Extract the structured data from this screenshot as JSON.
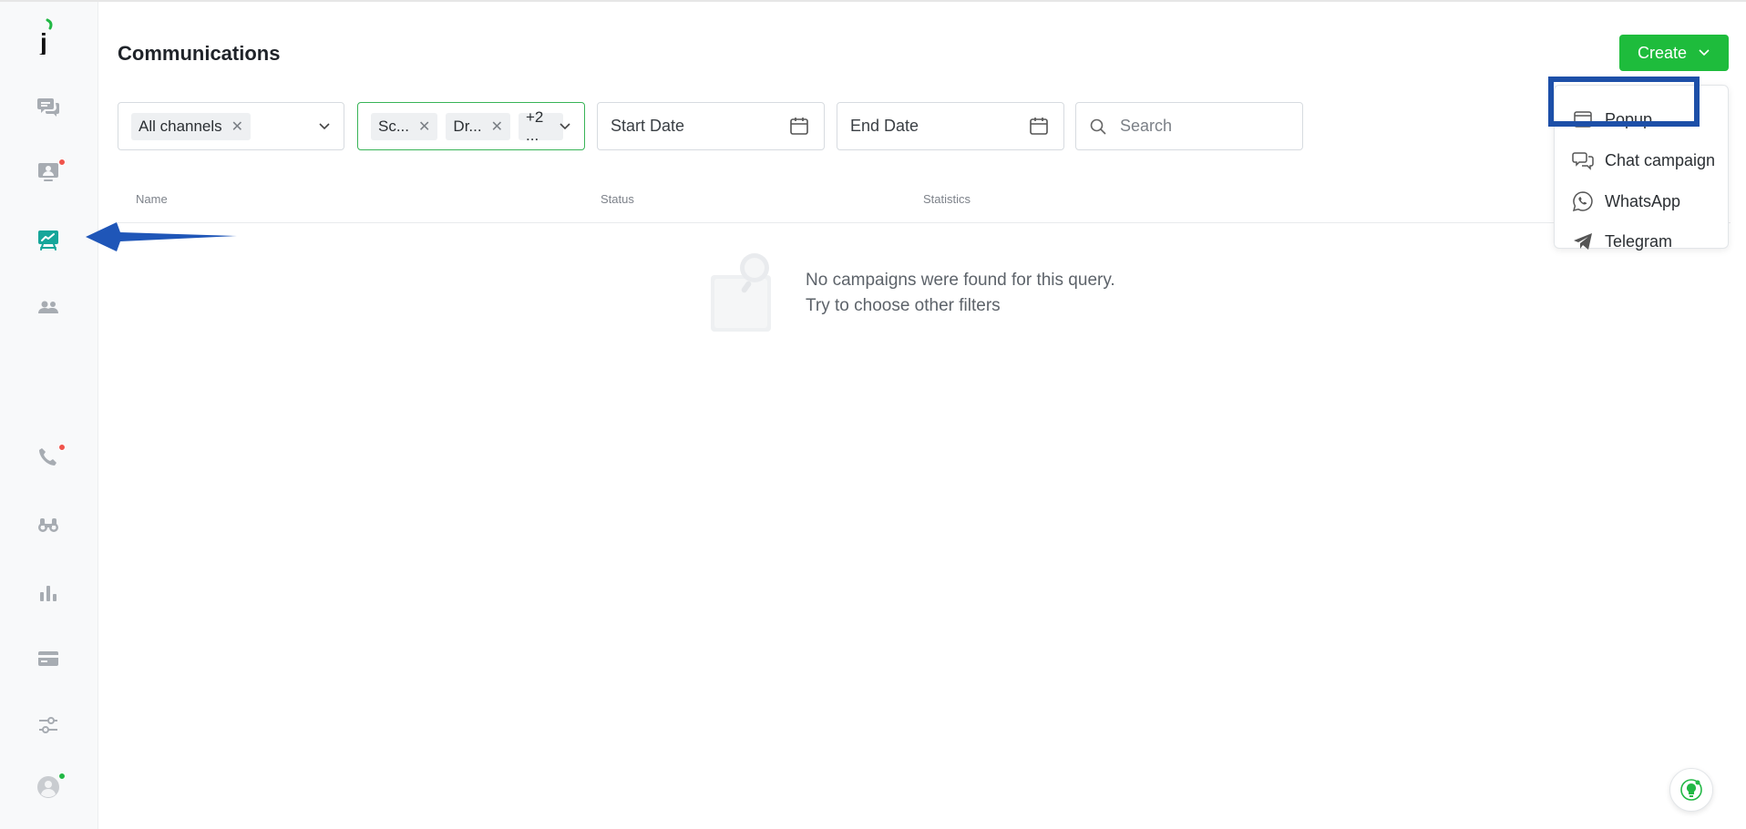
{
  "page": {
    "title": "Communications"
  },
  "header": {
    "create_label": "Create"
  },
  "filters": {
    "channels": {
      "chips": [
        "All channels"
      ]
    },
    "statuses": {
      "chips": [
        "Sc...",
        "Dr...",
        "+2 ..."
      ]
    },
    "start_date_placeholder": "Start Date",
    "end_date_placeholder": "End Date",
    "search_placeholder": "Search"
  },
  "table": {
    "columns": [
      "Name",
      "Status",
      "Statistics"
    ]
  },
  "empty_state": {
    "line1": "No campaigns were found for this query.",
    "line2": "Try to choose other filters"
  },
  "create_menu": {
    "items": [
      {
        "label": "Popup",
        "icon": "popup-window-icon"
      },
      {
        "label": "Chat campaign",
        "icon": "chat-bubbles-icon"
      },
      {
        "label": "WhatsApp",
        "icon": "whatsapp-icon"
      },
      {
        "label": "Telegram",
        "icon": "telegram-icon"
      }
    ]
  },
  "sidebar": {
    "items": [
      {
        "icon": "chats-icon",
        "active": false
      },
      {
        "icon": "visitors-icon",
        "active": false,
        "notification": true
      },
      {
        "icon": "campaigns-icon",
        "active": true
      },
      {
        "icon": "team-icon",
        "active": false
      },
      {
        "icon": "calls-icon",
        "active": false,
        "notification": true
      },
      {
        "icon": "binoculars-icon",
        "active": false
      },
      {
        "icon": "reports-icon",
        "active": false
      },
      {
        "icon": "billing-icon",
        "active": false
      },
      {
        "icon": "settings-sliders-icon",
        "active": false
      },
      {
        "icon": "user-avatar-icon",
        "active": false,
        "online": true
      }
    ]
  },
  "colors": {
    "brand_green": "#1ebc3c",
    "active_icon": "#16a69a",
    "highlight_box": "#1d4fa8",
    "notification_dot": "#f0544c"
  }
}
